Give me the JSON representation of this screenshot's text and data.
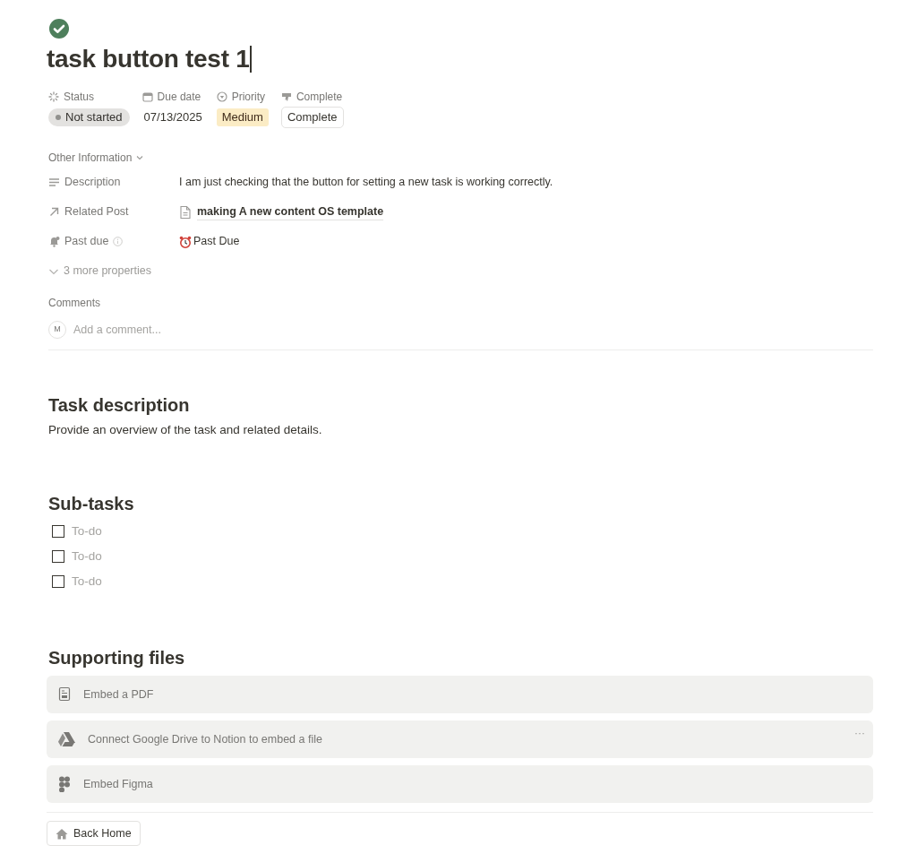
{
  "page": {
    "title": "task button test 1",
    "done": true
  },
  "properties": [
    {
      "kind": "status",
      "label": "Status",
      "value": "Not started"
    },
    {
      "kind": "date",
      "label": "Due date",
      "value": "07/13/2025"
    },
    {
      "kind": "priority",
      "label": "Priority",
      "value": "Medium"
    },
    {
      "kind": "button",
      "label": "Complete",
      "value": "Complete"
    }
  ],
  "other_information": {
    "heading": "Other Information",
    "rows": [
      {
        "kind": "text",
        "label": "Description",
        "value": "I am just checking that the button for setting a new task is working correctly."
      },
      {
        "kind": "relation",
        "label": "Related Post",
        "value": "making A new content OS template"
      },
      {
        "kind": "formula",
        "label": "Past due",
        "value": "Past Due"
      }
    ],
    "more": "3 more properties"
  },
  "comments": {
    "heading": "Comments",
    "avatar": "M",
    "placeholder": "Add a comment..."
  },
  "sections": [
    {
      "heading": "Task description",
      "text": "Provide an overview of the task and related details."
    },
    {
      "heading": "Sub-tasks",
      "todos": [
        {
          "text": "To-do",
          "checked": false
        },
        {
          "text": "To-do",
          "checked": false
        },
        {
          "text": "To-do",
          "checked": false
        }
      ]
    },
    {
      "heading": "Supporting files",
      "embeds": [
        {
          "kind": "pdf",
          "label": "Embed a PDF"
        },
        {
          "kind": "drive",
          "label": "Connect Google Drive to Notion to embed a file",
          "menu": "···"
        },
        {
          "kind": "figma",
          "label": "Embed Figma"
        }
      ]
    }
  ],
  "back_button": "Back Home"
}
